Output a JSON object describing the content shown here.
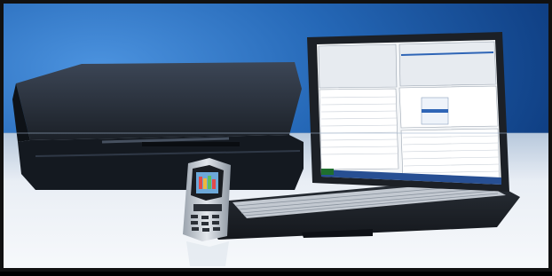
{
  "scene": {
    "description_alt": "",
    "colors": {
      "background_top": "#0b3f86",
      "background_mid": "#2a6fbf",
      "floor": "#e9eef5",
      "case_dark": "#1b2027",
      "laptop_body": "#1e2228",
      "keyboard_keys": "#d7dbe0",
      "phone_body": "#c9ced4",
      "screen_bg": "#f4f6f8",
      "taskbar": "#1f6f2e"
    },
    "objects": {
      "laptop_screen_label": "",
      "phone_brand": "",
      "screen_status_text": ""
    }
  }
}
